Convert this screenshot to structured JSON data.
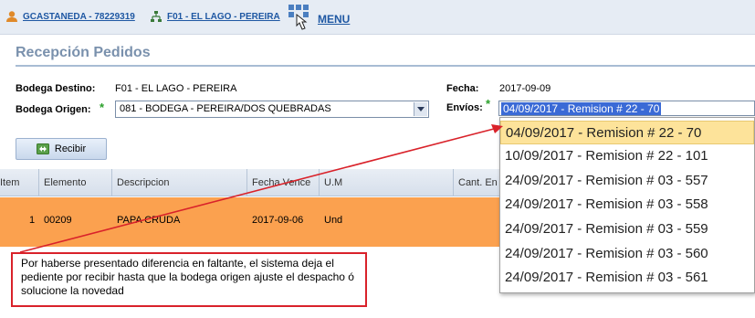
{
  "topbar": {
    "user_label": "GCASTANEDA - 78229319",
    "site_label": "F01 - EL LAGO - PEREIRA",
    "menu_label": "MENU"
  },
  "page": {
    "title": "Recepción Pedidos"
  },
  "form": {
    "bodega_destino_label": "Bodega Destino:",
    "bodega_destino_value": "F01 - EL LAGO - PEREIRA",
    "bodega_origen_label": "Bodega Origen:",
    "bodega_origen_value": "081 - BODEGA - PEREIRA/DOS QUEBRADAS",
    "required_mark": "*",
    "fecha_label": "Fecha:",
    "fecha_value": "2017-09-09",
    "envios_label": "Envíos:",
    "envios_value": "04/09/2017 - Remision # 22 - 70"
  },
  "toolbar": {
    "recibir_label": "Recibir"
  },
  "grid": {
    "columns": [
      "Item",
      "Elemento",
      "Descripcion",
      "Fecha Vence",
      "U.M",
      "Cant. En"
    ],
    "rows": [
      {
        "item": "1",
        "elemento": "00209",
        "descripcion": "PAPA CRUDA",
        "fecha_vence": "2017-09-06",
        "um": "Und"
      }
    ]
  },
  "envios_options": [
    "04/09/2017 - Remision # 22 - 70",
    "10/09/2017 - Remision # 22 - 101",
    "24/09/2017 - Remision # 03 - 557",
    "24/09/2017 - Remision # 03 - 558",
    "24/09/2017 - Remision # 03 - 559",
    "24/09/2017 - Remision # 03 - 560",
    "24/09/2017 - Remision # 03 - 561"
  ],
  "annotation": {
    "text": "Por haberse presentado diferencia en faltante, el sistema deja el pediente por recibir hasta que la bodega origen ajuste el despacho ó solucione la novedad"
  },
  "colors": {
    "link_blue": "#1f58a3",
    "row_highlight": "#fba14f",
    "selected_option": "#fde39a",
    "callout_border": "#d9222a",
    "required_green": "#2aa02a"
  }
}
